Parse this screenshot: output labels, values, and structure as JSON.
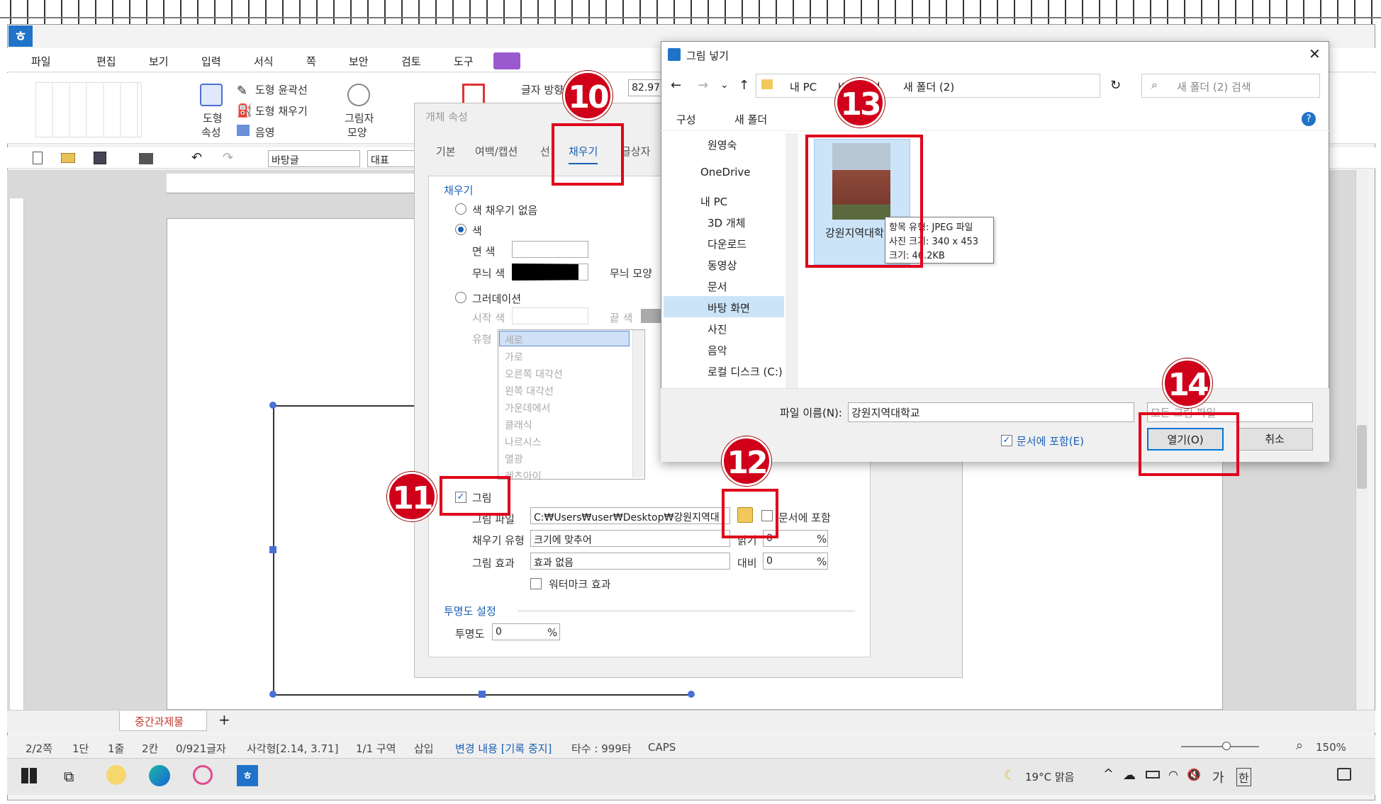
{
  "menubar": {
    "items": [
      "파일",
      "편집",
      "보기",
      "입력",
      "서식",
      "쪽",
      "보안",
      "검토",
      "도구"
    ]
  },
  "ribbon": {
    "shape_outline": "도형 윤곽선",
    "shape_fill": "도형 채우기",
    "shadow": "음영",
    "shape_props": "도형",
    "shape_props2": "속성",
    "picture_shape": "그림자",
    "picture_shape2": "모양",
    "text_direction": "글자 방향",
    "size_value": "82.97"
  },
  "toolbar2": {
    "style_select": "바탕글",
    "font_select": "대표"
  },
  "obj_dialog": {
    "title": "개체 속성",
    "tabs": [
      "기본",
      "여백/캡션",
      "선",
      "채우기",
      "글상자"
    ],
    "fill_section": "채우기",
    "no_fill": "색 채우기 없음",
    "color": "색",
    "face_color": "면 색",
    "pattern_color": "무늬 색",
    "pattern_shape": "무늬 모양",
    "gradation": "그러데이션",
    "start_color": "시작 색",
    "end_color": "끝 색",
    "type": "유형",
    "type_options": [
      "세로",
      "가로",
      "오른쪽 대각선",
      "왼쪽 대각선",
      "가운데에서",
      "클래식",
      "나르시스",
      "열광",
      "레츠아이"
    ],
    "picture": "그림",
    "picture_file": "그림 파일",
    "picture_path": "C:₩Users₩user₩Desktop₩강원지역대",
    "include_doc": "문서에 포함",
    "fill_type_label": "채우기 유형",
    "fill_type_value": "크기에 맞추어",
    "brightness": "밝기",
    "brightness_value": "0",
    "picture_effect_label": "그림 효과",
    "picture_effect_value": "효과 없음",
    "contrast": "대비",
    "contrast_value": "0",
    "watermark": "워터마크 효과",
    "transparency_section": "투명도 설정",
    "transparency": "투명도",
    "transparency_value": "0",
    "percent": "%"
  },
  "file_dialog": {
    "title": "그림 넣기",
    "path": [
      "내 PC",
      "바탕 화면",
      "새 폴더 (2)"
    ],
    "search_placeholder": "새 폴더 (2) 검색",
    "organize": "구성",
    "new_folder": "새 폴더",
    "nav_items": [
      "원영숙",
      "OneDrive",
      "내 PC",
      "3D 개체",
      "다운로드",
      "동영상",
      "문서",
      "바탕 화면",
      "사진",
      "음악",
      "로컬 디스크 (C:)"
    ],
    "file_name_short": "강원지역대학",
    "tooltip": [
      "항목 유형: JPEG 파일",
      "사진 크기: 340 x 453",
      "크기: 46.2KB"
    ],
    "filename_label": "파일 이름(N):",
    "filename_value": "강원지역대학교",
    "filetype_value": "모든 그림 파일",
    "include_doc": "문서에 포함(E)",
    "open": "열기(O)",
    "cancel": "취소"
  },
  "badges": [
    "10",
    "11",
    "12",
    "13",
    "14"
  ],
  "sheet_tab": "중간과제물",
  "status": {
    "page": "2/2쪽",
    "col": "1단",
    "line": "1줄",
    "pos": "2칸",
    "chars": "0/921글자",
    "shape": "사각형[2.14, 3.71]",
    "section": "1/1 구역",
    "insert": "삽입",
    "track": "변경 내용 [기록 중지]",
    "typing": "타수 : 999타",
    "caps": "CAPS",
    "zoom": "150%"
  },
  "taskbar": {
    "weather": "19°C 맑음",
    "ime1": "가",
    "ime2": "한"
  },
  "colors": {
    "accent": "#1a5fb4",
    "badge": "#d0001a",
    "red_box": "#e0001b"
  }
}
